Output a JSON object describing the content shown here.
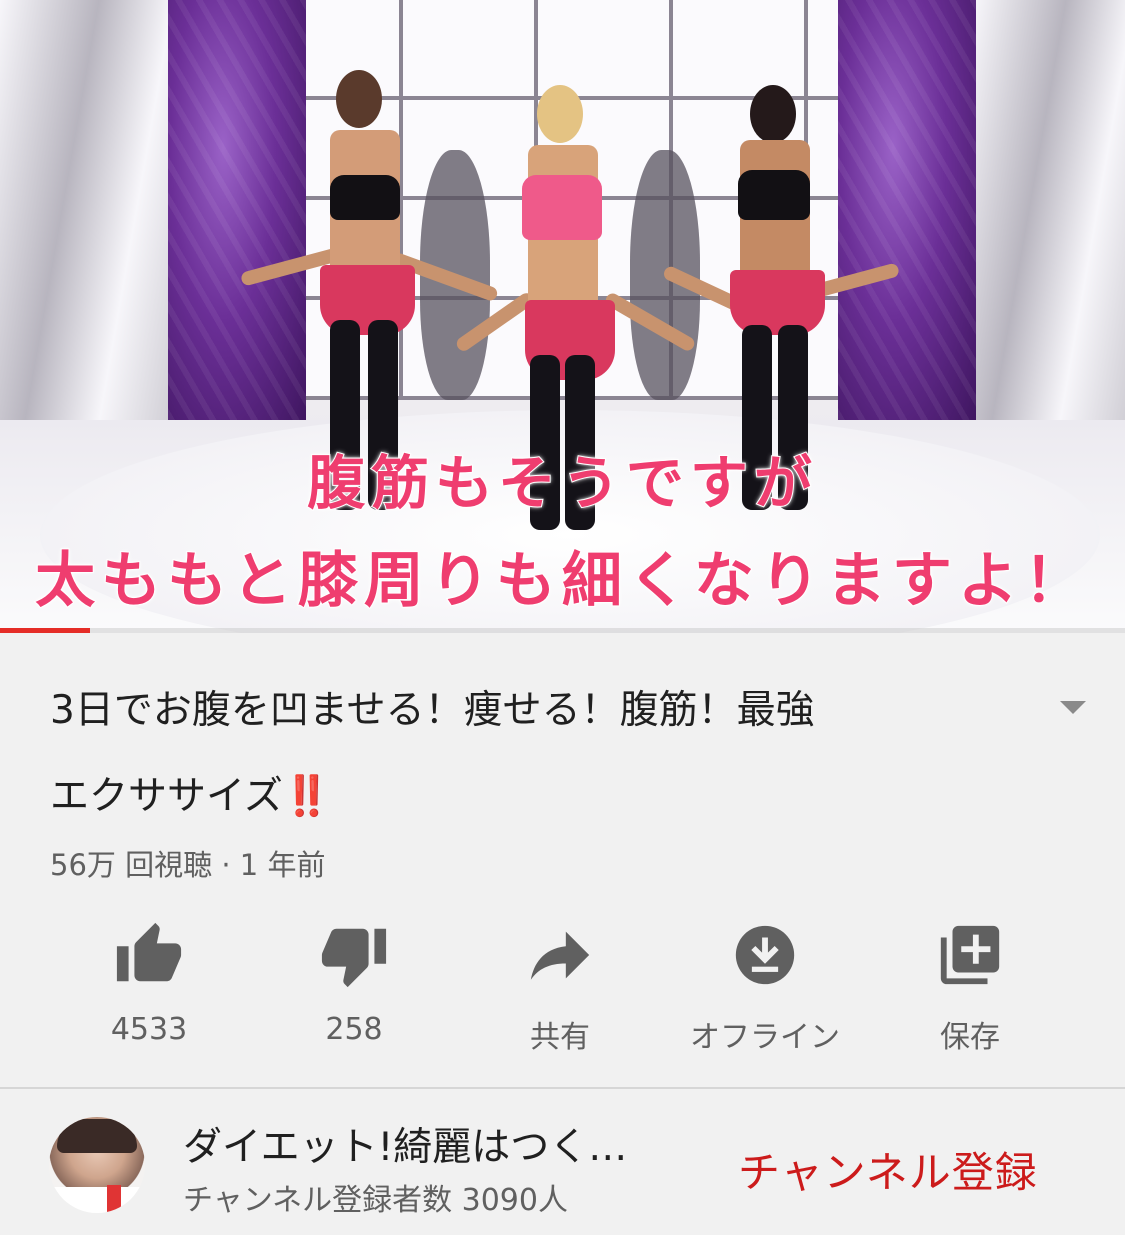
{
  "video": {
    "caption_line1": "腹筋もそうですが",
    "caption_line2": "太ももと膝周りも細くなりますよ！",
    "progress_percent": 8
  },
  "title": {
    "line1": "3日でお腹を凹ませる！痩せる！腹筋！最強",
    "line2": "エクササイズ",
    "emoji": "‼️"
  },
  "meta": {
    "views": "56万 回視聴",
    "separator": "·",
    "age": "1 年前"
  },
  "actions": [
    {
      "icon": "thumbs-up-icon",
      "label": "4533"
    },
    {
      "icon": "thumbs-down-icon",
      "label": "258"
    },
    {
      "icon": "share-icon",
      "label": "共有"
    },
    {
      "icon": "download-icon",
      "label": "オフライン"
    },
    {
      "icon": "playlist-add-icon",
      "label": "保存"
    }
  ],
  "channel": {
    "name": "ダイエット!綺麗はつく…",
    "subscribers": "チャンネル登録者数 3090人",
    "subscribe_label": "チャンネル登録"
  },
  "colors": {
    "accent": "#e52d27",
    "subscribe": "#cc1b1b",
    "secondary_text": "#606060",
    "icon": "#606060"
  }
}
